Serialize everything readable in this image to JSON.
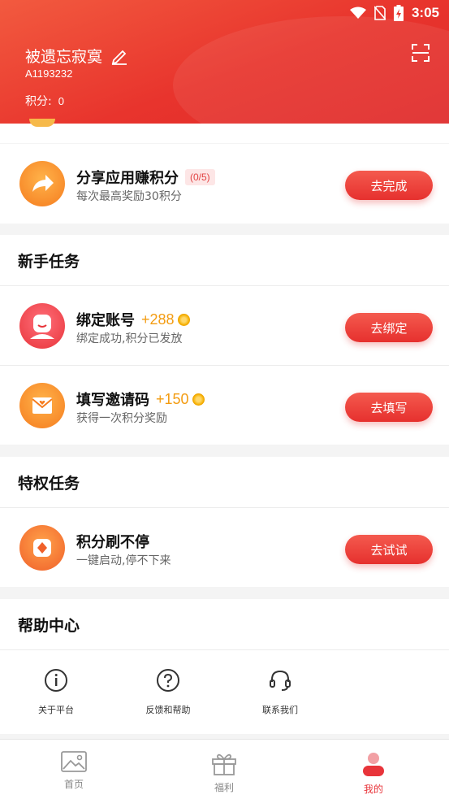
{
  "status_bar": {
    "time": "3:05"
  },
  "profile": {
    "username": "被遗忘寂寞",
    "user_id": "A1193232",
    "points_label": "积分:",
    "points_value": "0"
  },
  "share_task": {
    "title": "分享应用赚积分",
    "progress": "(0/5)",
    "subtitle": "每次最高奖励30积分",
    "button": "去完成"
  },
  "newbie_section": {
    "title": "新手任务",
    "tasks": [
      {
        "title": "绑定账号",
        "bonus": "+288",
        "subtitle": "绑定成功,积分已发放",
        "button": "去绑定"
      },
      {
        "title": "填写邀请码",
        "bonus": "+150",
        "subtitle": "获得一次积分奖励",
        "button": "去填写"
      }
    ]
  },
  "privilege_section": {
    "title": "特权任务",
    "tasks": [
      {
        "title": "积分刷不停",
        "subtitle": "一键启动,停不下来",
        "button": "去试试"
      }
    ]
  },
  "help_section": {
    "title": "帮助中心",
    "items": [
      {
        "label": "关于平台",
        "icon": "info-icon"
      },
      {
        "label": "反馈和帮助",
        "icon": "question-icon"
      },
      {
        "label": "联系我们",
        "icon": "headset-icon"
      }
    ]
  },
  "bottom_nav": {
    "items": [
      {
        "label": "首页",
        "icon": "image-icon",
        "active": false
      },
      {
        "label": "福利",
        "icon": "gift-icon",
        "active": false
      },
      {
        "label": "我的",
        "icon": "user-icon",
        "active": true
      }
    ]
  },
  "colors": {
    "brand_red": "#e8342d",
    "bonus_orange": "#f39c12",
    "active_nav": "#e8343a"
  }
}
